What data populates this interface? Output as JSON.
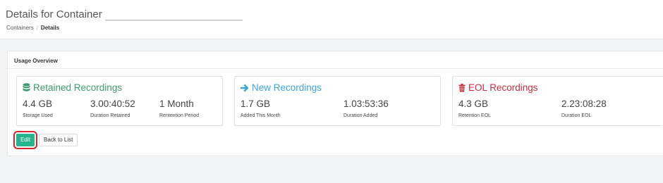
{
  "header": {
    "title": "Details for Container",
    "breadcrumb": {
      "parent": "Containers",
      "separator": "/",
      "current": "Details"
    }
  },
  "panel": {
    "title": "Usage Overview",
    "cards": [
      {
        "title": "Retained Recordings",
        "icon": "database-icon",
        "color": "#3c9a6e",
        "stats": [
          {
            "value": "4.4 GB",
            "label": "Storage Used"
          },
          {
            "value": "3.00:40:52",
            "label": "Duration Retained"
          },
          {
            "value": "1 Month",
            "label": "Rentention Period"
          }
        ]
      },
      {
        "title": "New Recordings",
        "icon": "arrow-right-icon",
        "color": "#3ba6d8",
        "stats": [
          {
            "value": "1.7 GB",
            "label": "Added This Month"
          },
          {
            "value": "1.03:53:36",
            "label": "Duration Added"
          }
        ]
      },
      {
        "title": "EOL Recordings",
        "icon": "trash-icon",
        "color": "#cc2b3c",
        "stats": [
          {
            "value": "4.3 GB",
            "label": "Retention EOL"
          },
          {
            "value": "2.23:08:28",
            "label": "Duration EOL"
          }
        ]
      }
    ]
  },
  "actions": {
    "edit_label": "Edit",
    "back_label": "Back to List"
  },
  "colors": {
    "accent": "#26b490",
    "highlight": "#d9232f"
  }
}
